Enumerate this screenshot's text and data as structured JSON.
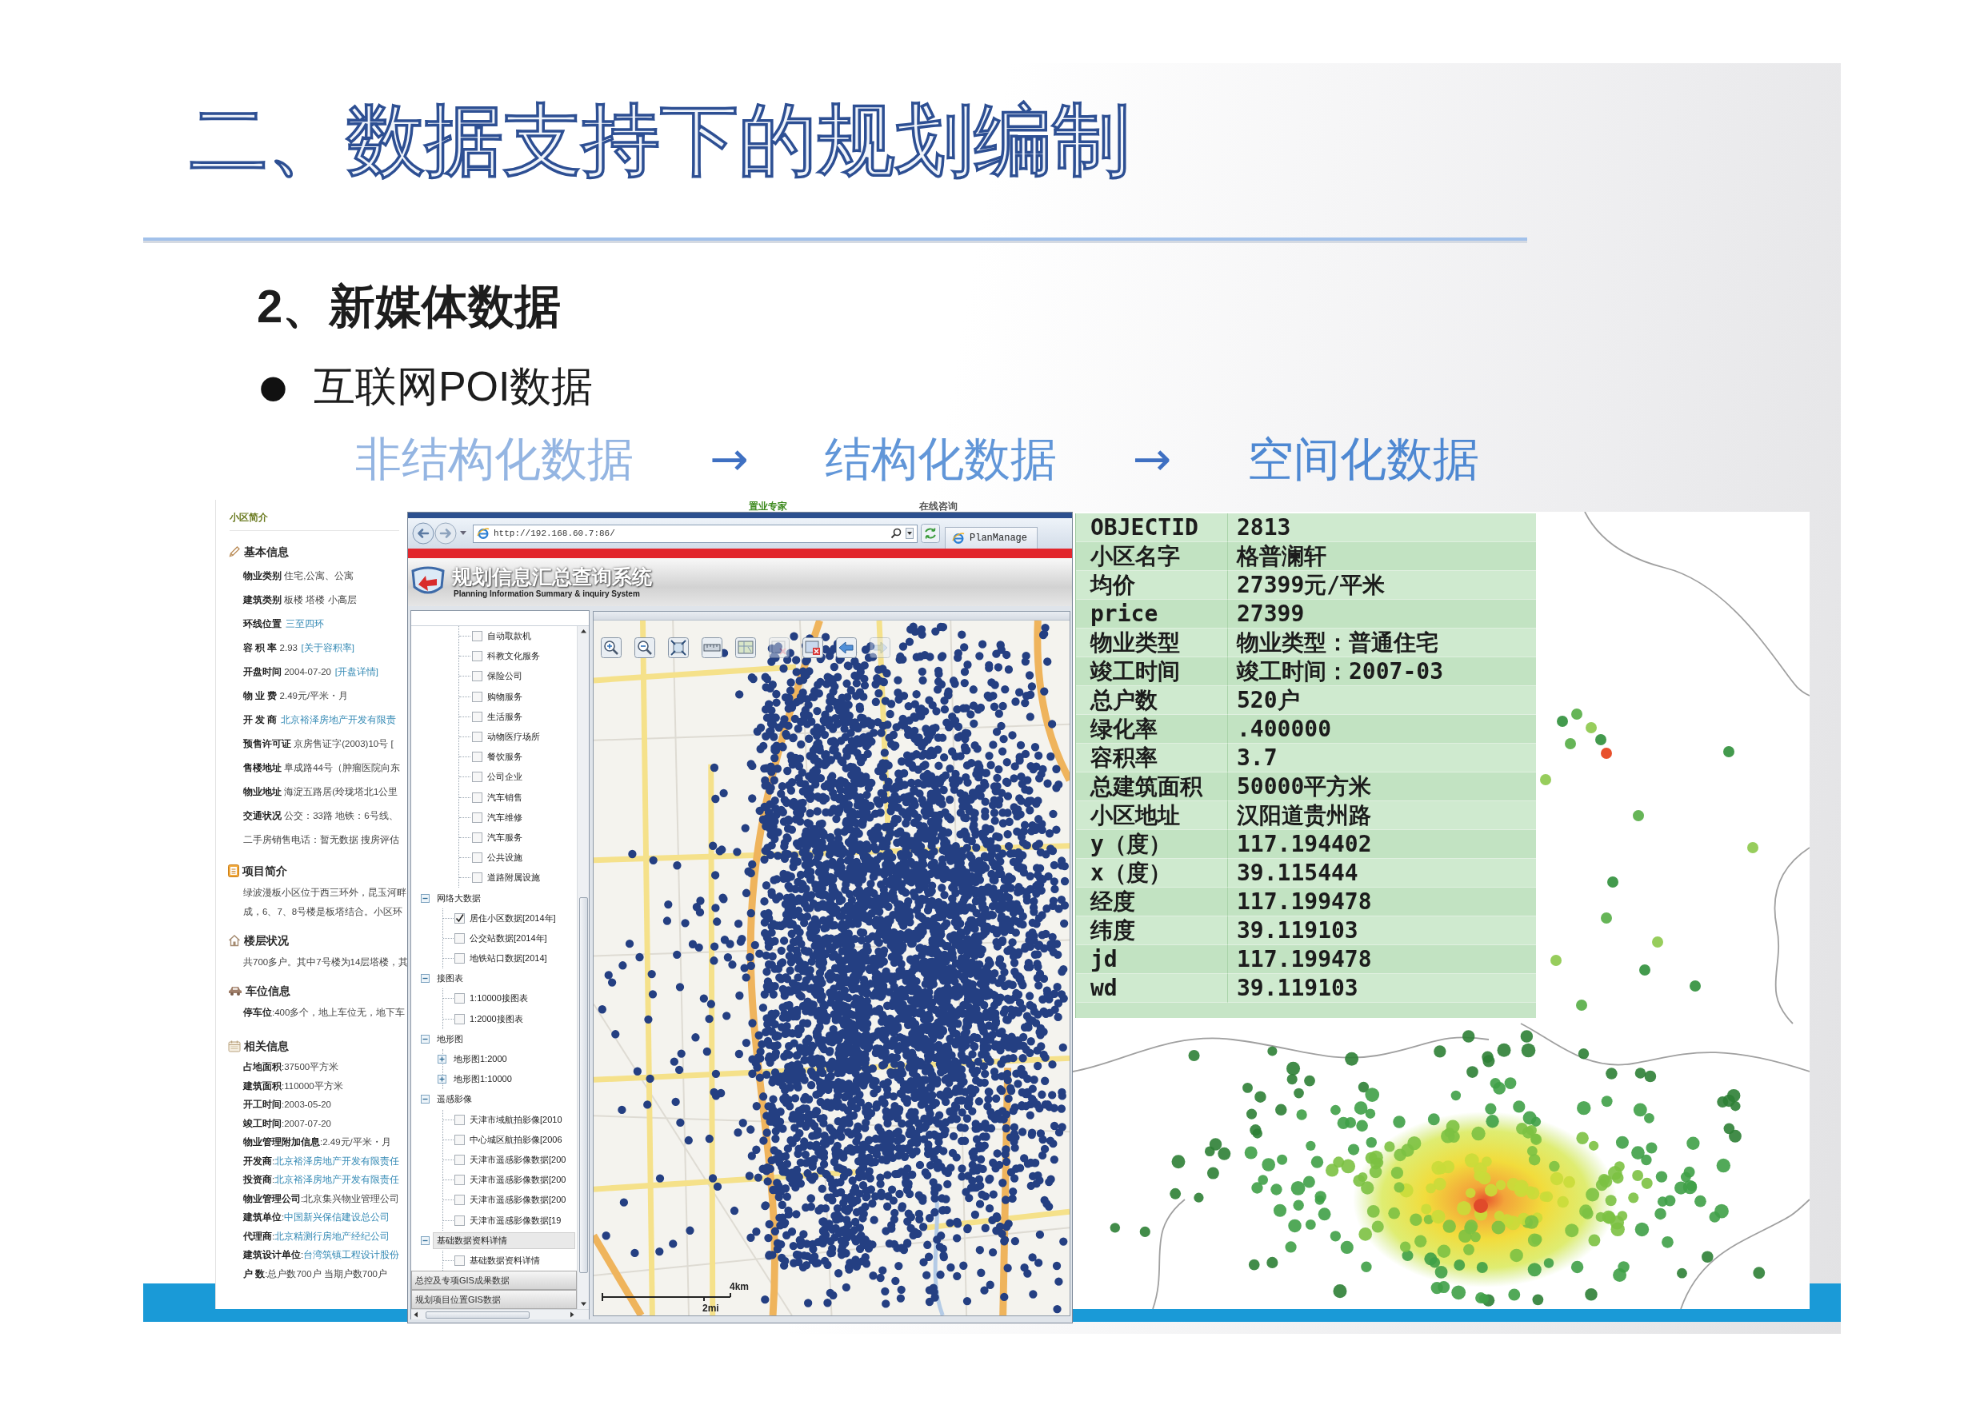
{
  "slide": {
    "title": "二、数据支持下的规划编制",
    "subheading": "2、新媒体数据",
    "bullet": {
      "marker": "●",
      "text": "互联网POI数据"
    },
    "flow": [
      {
        "kind": "step",
        "text": "非结构化数据",
        "color": "#94b5e2"
      },
      {
        "kind": "arrow",
        "text": "→"
      },
      {
        "kind": "step",
        "text": "结构化数据",
        "color": "#6196d8"
      },
      {
        "kind": "arrow",
        "text": "→"
      },
      {
        "kind": "step",
        "text": "空间化数据",
        "color": "#4e88d2"
      }
    ]
  },
  "community_page": {
    "header": "小区简介",
    "sections": [
      {
        "kind": "basic",
        "title": "基本信息",
        "rows": [
          {
            "text": "**物业类别** 住宅,公寓、公寓"
          },
          {
            "text": "**建筑类别** 板楼 塔楼 小高层"
          },
          {
            "text": "**环线位置**",
            "link": "三至四环"
          },
          {
            "text": "**容 积 率** 2.93",
            "link": "[关于容积率]"
          },
          {
            "text": "**开盘时间** 2004-07-20",
            "link": "[开盘详情]"
          },
          {
            "text": "**物 业 费** 2.49元/平米・月"
          },
          {
            "text": "**开 发 商**",
            "link": "北京裕泽房地产开发有限责"
          },
          {
            "text": "**预售许可证** 京房售证字(2003)10号 ["
          },
          {
            "text": "**售楼地址** 阜成路44号（肿瘤医院向东"
          },
          {
            "text": "**物业地址** 海淀五路居(玲珑塔北1公里"
          },
          {
            "text": "**交通状况** 公交：33路 地铁：6号线、"
          },
          {
            "text": "二手房销售电话：暂无数据 搜房评估"
          }
        ]
      },
      {
        "kind": "intro",
        "title": "项目简介",
        "rows": [
          {
            "text": "绿波漫板小区位于西三环外，昆玉河畔"
          },
          {
            "text": "成，6、7、8号楼是板塔结合。小区环"
          }
        ]
      },
      {
        "kind": "floors",
        "title": "楼层状况",
        "rows": [
          {
            "text": "共700多户。其中7号楼为14层塔楼，其"
          }
        ]
      },
      {
        "kind": "parking",
        "title": "车位信息",
        "rows": [
          {
            "text": "**停车位**:400多个，地上车位无，地下车"
          }
        ]
      },
      {
        "kind": "related",
        "title": "相关信息",
        "rows": [
          {
            "text": "**占地面积**:37500平方米"
          },
          {
            "text": "**建筑面积**:110000平方米"
          },
          {
            "text": "**开工时间**:2003-05-20"
          },
          {
            "text": "**竣工时间**:2007-07-20"
          },
          {
            "text": "**物业管理附加信息**:2.49元/平米・月"
          },
          {
            "text": "**开发商**:",
            "link": "北京裕泽房地产开发有限责任"
          },
          {
            "text": "**投资商**:",
            "link": "北京裕泽房地产开发有限责任"
          },
          {
            "text": "**物业管理公司**:北京集兴物业管理公司"
          },
          {
            "text": "**建筑单位**:",
            "link": "中国新兴保信建设总公司"
          },
          {
            "text": "**代理商**:",
            "link": "北京精测行房地产经纪公司"
          },
          {
            "text": "**建筑设计单位**:",
            "link": "台湾筑镇工程设计股份"
          },
          {
            "text": "**户 数**:总户数700户 当期户数700户"
          }
        ]
      }
    ]
  },
  "browser": {
    "background_links": [
      {
        "text": "置业专家",
        "color": "#3d8a1e"
      },
      {
        "text": "在线咨询",
        "color": "#555555"
      }
    ],
    "address": "http://192.168.60.7:86/",
    "tab_title": "PlanManage",
    "app_title": "规划信息汇总查询系统",
    "app_subtitle": "Planning Information Summary & inquiry System",
    "tree": {
      "continued_items": [
        {
          "label": "自动取款机",
          "checked": false
        },
        {
          "label": "科教文化服务",
          "checked": false
        },
        {
          "label": "保险公司",
          "checked": false
        },
        {
          "label": "购物服务",
          "checked": false
        },
        {
          "label": "生活服务",
          "checked": false
        },
        {
          "label": "动物医疗场所",
          "checked": false
        },
        {
          "label": "餐饮服务",
          "checked": false
        },
        {
          "label": "公司企业",
          "checked": false
        },
        {
          "label": "汽车销售",
          "checked": false
        },
        {
          "label": "汽车维修",
          "checked": false
        },
        {
          "label": "汽车服务",
          "checked": false
        },
        {
          "label": "公共设施",
          "checked": false
        },
        {
          "label": "道路附属设施",
          "checked": false
        }
      ],
      "groups": [
        {
          "label": "网络大数据",
          "expanded": true,
          "selected": false,
          "children": [
            {
              "kind": "layer",
              "label": "居住小区数据[2014年]",
              "checked": true
            },
            {
              "kind": "layer",
              "label": "公交站数据[2014年]",
              "checked": false
            },
            {
              "kind": "layer",
              "label": "地铁站口数据[2014]",
              "checked": false
            }
          ]
        },
        {
          "label": "接图表",
          "expanded": true,
          "selected": false,
          "children": [
            {
              "kind": "layer",
              "label": "1:10000接图表",
              "checked": false
            },
            {
              "kind": "layer",
              "label": "1:2000接图表",
              "checked": false
            }
          ]
        },
        {
          "label": "地形图",
          "expanded": true,
          "selected": false,
          "children": [
            {
              "kind": "folder",
              "label": "地形图1:2000",
              "expanded": false
            },
            {
              "kind": "folder",
              "label": "地形图1:10000",
              "expanded": false
            }
          ]
        },
        {
          "label": "遥感影像",
          "expanded": true,
          "selected": false,
          "children": [
            {
              "kind": "layer",
              "label": "天津市域航拍影像[2010",
              "checked": false
            },
            {
              "kind": "layer",
              "label": "中心城区航拍影像[2006",
              "checked": false
            },
            {
              "kind": "layer",
              "label": "天津市遥感影像数据[200",
              "checked": false
            },
            {
              "kind": "layer",
              "label": "天津市遥感影像数据[200",
              "checked": false
            },
            {
              "kind": "layer",
              "label": "天津市遥感影像数据[200",
              "checked": false
            },
            {
              "kind": "layer",
              "label": "天津市遥感影像数据[19",
              "checked": false
            }
          ]
        },
        {
          "label": "基础数据资料详情",
          "expanded": true,
          "selected": true,
          "children": [
            {
              "kind": "layer",
              "label": "基础数据资料详情",
              "checked": false
            }
          ]
        }
      ]
    },
    "accordion": [
      {
        "label": "总控及专项GIS成果数据"
      },
      {
        "label": "规划项目位置GIS数据"
      }
    ],
    "map": {
      "tools": [
        {
          "kind": "zoom_in",
          "disabled": false
        },
        {
          "kind": "zoom_out",
          "disabled": false
        },
        {
          "kind": "full_extent",
          "disabled": false
        },
        {
          "kind": "measure",
          "disabled": false
        },
        {
          "kind": "layers",
          "disabled": false
        },
        {
          "kind": "clear",
          "disabled": true
        },
        {
          "kind": "delete",
          "disabled": false
        },
        {
          "kind": "back",
          "disabled": false
        },
        {
          "kind": "forward",
          "disabled": true
        }
      ],
      "scale": {
        "metric": "4km",
        "imperial": "2mi"
      }
    }
  },
  "attribute_table": {
    "rows": [
      {
        "field": "OBJECTID",
        "value": "2813"
      },
      {
        "field": "小区名字",
        "value": "格普澜轩"
      },
      {
        "field": "均价",
        "value": "27399元/平米"
      },
      {
        "field": "price",
        "value": "27399"
      },
      {
        "field": "物业类型",
        "value": "物业类型：普通住宅"
      },
      {
        "field": "竣工时间",
        "value": "竣工时间：2007-03"
      },
      {
        "field": "总户数",
        "value": "520户"
      },
      {
        "field": "绿化率",
        "value": ".400000"
      },
      {
        "field": "容积率",
        "value": "3.7"
      },
      {
        "field": "总建筑面积",
        "value": "50000平方米"
      },
      {
        "field": "小区地址",
        "value": "汉阳道贵州路"
      },
      {
        "field": "y（度）",
        "value": "117.194402"
      },
      {
        "field": "x（度）",
        "value": "39.115444"
      },
      {
        "field": "经度",
        "value": "117.199478"
      },
      {
        "field": "纬度",
        "value": "39.119103"
      },
      {
        "field": "jd",
        "value": "117.199478"
      },
      {
        "field": "wd",
        "value": "39.119103"
      }
    ]
  }
}
